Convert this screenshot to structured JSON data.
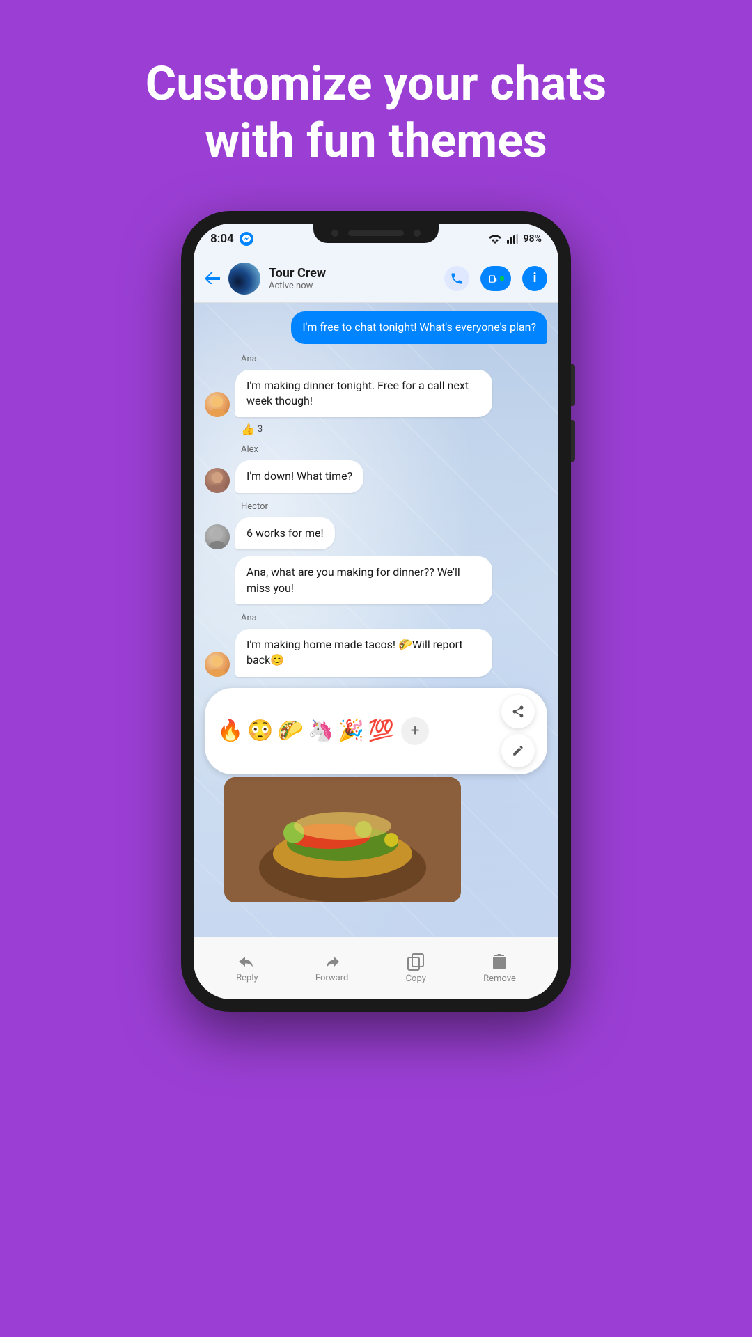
{
  "hero": {
    "line1": "Customize your chats",
    "line2": "with fun themes"
  },
  "status_bar": {
    "time": "8:04",
    "battery": "98%"
  },
  "header": {
    "group_name": "Tour Crew",
    "status": "Active now",
    "back_label": "←"
  },
  "messages": [
    {
      "id": "outgoing1",
      "type": "outgoing",
      "text": "I'm free to chat tonight! What's everyone's plan?"
    },
    {
      "id": "ana1",
      "type": "incoming",
      "sender": "Ana",
      "avatar": "ana",
      "text": "I'm making dinner tonight. Free for a call next week though!",
      "reaction": "👍",
      "reaction_count": "3"
    },
    {
      "id": "alex1",
      "type": "incoming",
      "sender": "Alex",
      "avatar": "alex",
      "text": "I'm down! What time?"
    },
    {
      "id": "hector1",
      "type": "incoming",
      "sender": "Hector",
      "avatar": "hector",
      "text": "6 works for me!"
    },
    {
      "id": "hector2",
      "type": "incoming",
      "sender": "",
      "avatar": "hector",
      "text": "Ana, what are you making for dinner?? We'll miss you!"
    },
    {
      "id": "ana2",
      "type": "incoming",
      "sender": "Ana",
      "avatar": "ana2",
      "text": "I'm making home made tacos! 🌮Will report back😊"
    }
  ],
  "emoji_bar": {
    "emojis": [
      "🔥",
      "😳",
      "🌮",
      "🦄",
      "🎉",
      "💯"
    ],
    "plus_label": "+"
  },
  "action_buttons": [
    {
      "id": "share",
      "icon": "share"
    },
    {
      "id": "edit",
      "icon": "edit"
    }
  ],
  "toolbar": {
    "items": [
      {
        "id": "reply",
        "label": "Reply",
        "icon": "reply"
      },
      {
        "id": "forward",
        "label": "Forward",
        "icon": "forward"
      },
      {
        "id": "copy",
        "label": "Copy",
        "icon": "copy"
      },
      {
        "id": "remove",
        "label": "Remove",
        "icon": "remove"
      }
    ]
  }
}
